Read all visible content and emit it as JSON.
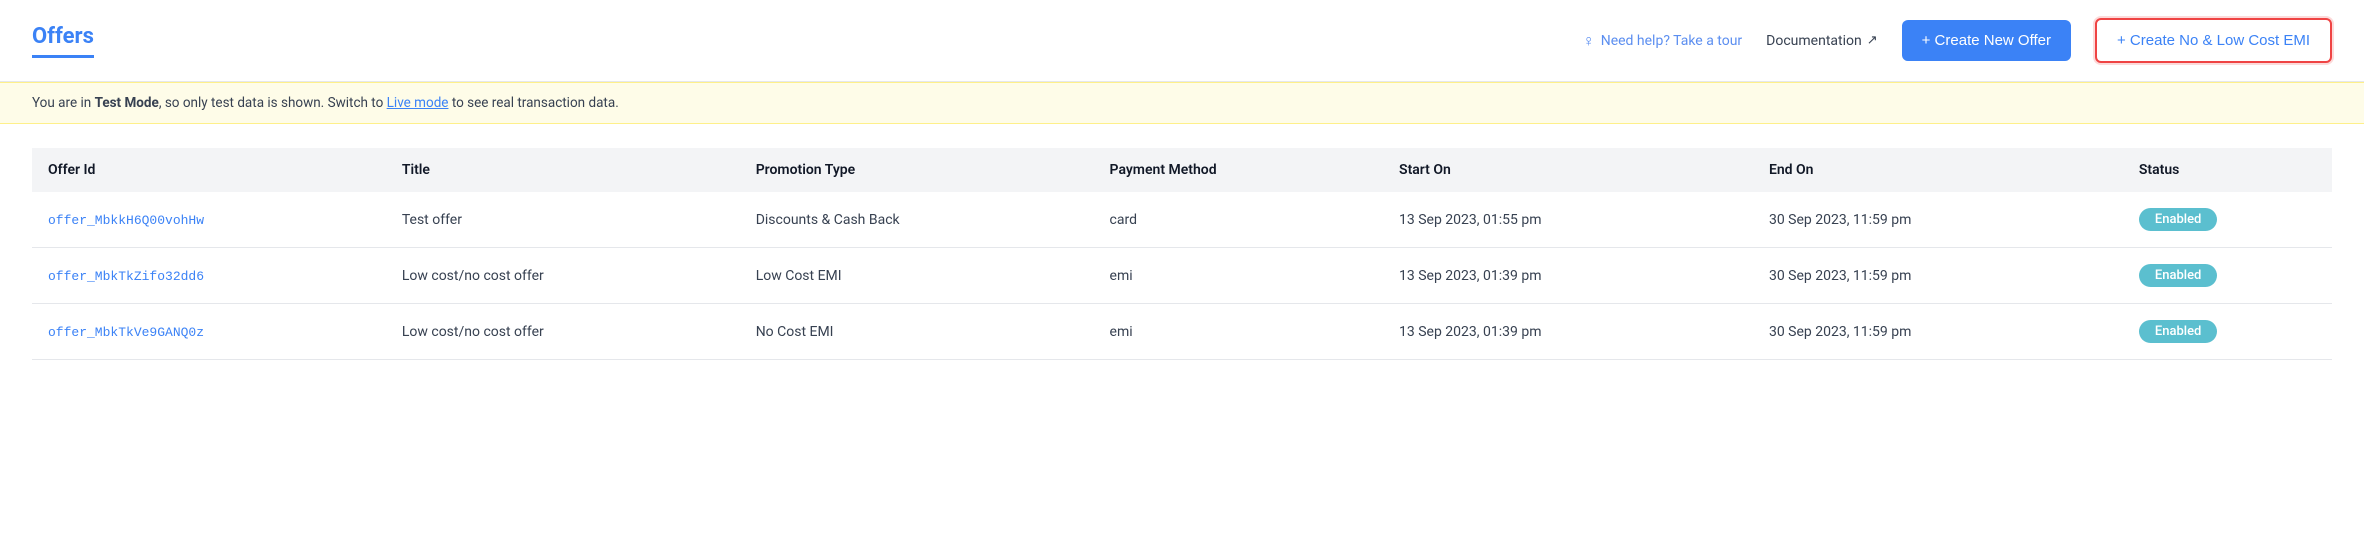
{
  "header": {
    "title": "Offers",
    "help_label": "Need help? Take a tour",
    "docs_label": "Documentation",
    "create_offer_label": "+ Create New Offer",
    "create_emi_label": "+ Create No & Low Cost EMI"
  },
  "banner": {
    "prefix": "You are in ",
    "mode": "Test Mode",
    "middle": ", so only test data is shown. Switch to ",
    "link": "Live mode",
    "suffix": " to see real transaction data."
  },
  "table": {
    "columns": [
      "Offer Id",
      "Title",
      "Promotion Type",
      "Payment Method",
      "Start On",
      "End On",
      "Status"
    ],
    "rows": [
      {
        "id": "offer_MbkkH6Q00vohHw",
        "title": "Test offer",
        "promotion_type": "Discounts & Cash Back",
        "payment_method": "card",
        "start_on": "13 Sep 2023, 01:55 pm",
        "end_on": "30 Sep 2023, 11:59 pm",
        "status": "Enabled"
      },
      {
        "id": "offer_MbkTkZifo32dd6",
        "title": "Low cost/no cost offer",
        "promotion_type": "Low Cost EMI",
        "payment_method": "emi",
        "start_on": "13 Sep 2023, 01:39 pm",
        "end_on": "30 Sep 2023, 11:59 pm",
        "status": "Enabled"
      },
      {
        "id": "offer_MbkTkVe9GANQ0z",
        "title": "Low cost/no cost offer",
        "promotion_type": "No Cost EMI",
        "payment_method": "emi",
        "start_on": "13 Sep 2023, 01:39 pm",
        "end_on": "30 Sep 2023, 11:59 pm",
        "status": "Enabled"
      }
    ]
  }
}
